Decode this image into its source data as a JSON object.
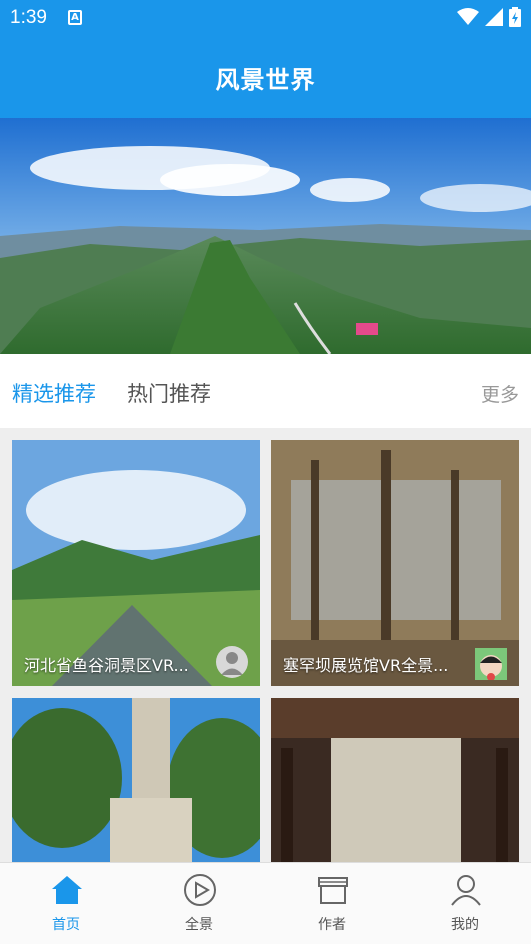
{
  "status": {
    "time": "1:39"
  },
  "header": {
    "title": "风景世界"
  },
  "banner": {
    "slides": 2,
    "active_slide": 2
  },
  "tabs": {
    "featured": "精选推荐",
    "popular": "热门推荐",
    "more": "更多"
  },
  "cards": [
    {
      "title": "河北省鱼谷洞景区VR..."
    },
    {
      "title": "塞罕坝展览馆VR全景..."
    },
    {
      "title": ""
    },
    {
      "title": ""
    }
  ],
  "nav": [
    {
      "label": "首页",
      "icon": "home-icon",
      "active": true
    },
    {
      "label": "全景",
      "icon": "play-circle-icon",
      "active": false
    },
    {
      "label": "作者",
      "icon": "store-icon",
      "active": false
    },
    {
      "label": "我的",
      "icon": "user-icon",
      "active": false
    }
  ],
  "colors": {
    "primary": "#1a96ea",
    "text_muted": "#999999"
  }
}
